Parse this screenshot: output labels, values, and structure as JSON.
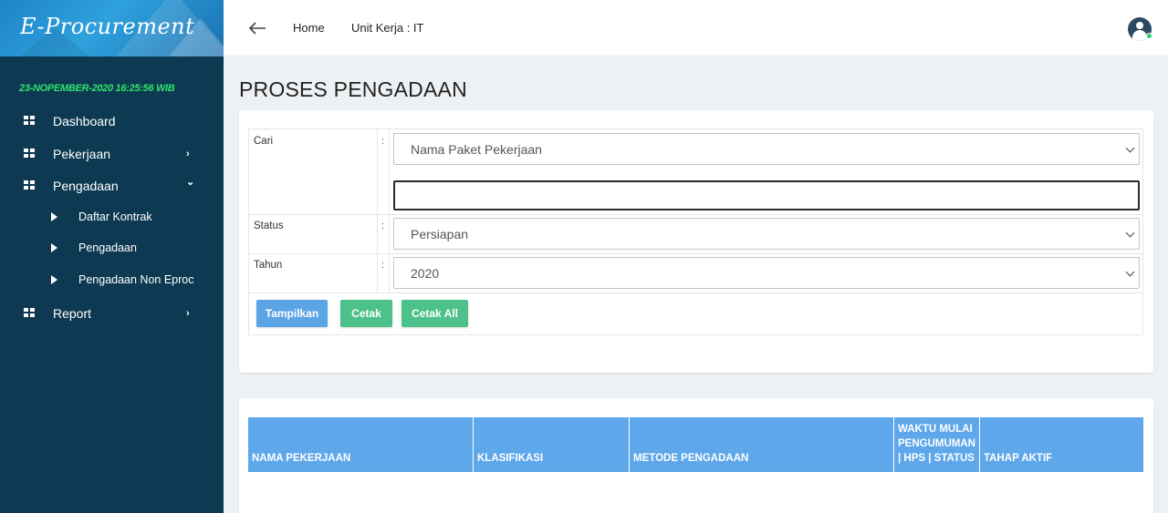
{
  "app": {
    "brand": "E-Procurement"
  },
  "sidebar": {
    "datetime": "23-NOPEMBER-2020 16:25:56 WIB",
    "items": [
      {
        "label": "Dashboard",
        "chevron": ""
      },
      {
        "label": "Pekerjaan",
        "chevron": "›"
      },
      {
        "label": "Pengadaan",
        "chevron": "⌄"
      },
      {
        "label": "Report",
        "chevron": "›"
      }
    ],
    "subitems": [
      {
        "label": "Daftar Kontrak"
      },
      {
        "label": "Pengadaan"
      },
      {
        "label": "Pengadaan Non Eproc"
      }
    ]
  },
  "topbar": {
    "home": "Home",
    "unit": "Unit Kerja : IT"
  },
  "page": {
    "title": "PROSES PENGADAAN"
  },
  "filter": {
    "cari_label": "Cari",
    "status_label": "Status",
    "tahun_label": "Tahun",
    "colon": ":",
    "cari_select": "Nama Paket Pekerjaan",
    "cari_text": "",
    "status_select": "Persiapan",
    "tahun_select": "2020",
    "buttons": {
      "tampilkan": "Tampilkan",
      "cetak": "Cetak",
      "cetak_all": "Cetak All"
    }
  },
  "table": {
    "columns": [
      "NAMA PEKERJAAN",
      "KLASIFIKASI",
      "METODE PENGADAAN",
      "WAKTU MULAI PENGUMUMAN | HPS | STATUS",
      "TAHAP AKTIF"
    ]
  },
  "colors": {
    "sidebar": "#0d3a52",
    "primary": "#5ba4e6",
    "success": "#4dc18a",
    "datetime": "#2fe36a"
  }
}
